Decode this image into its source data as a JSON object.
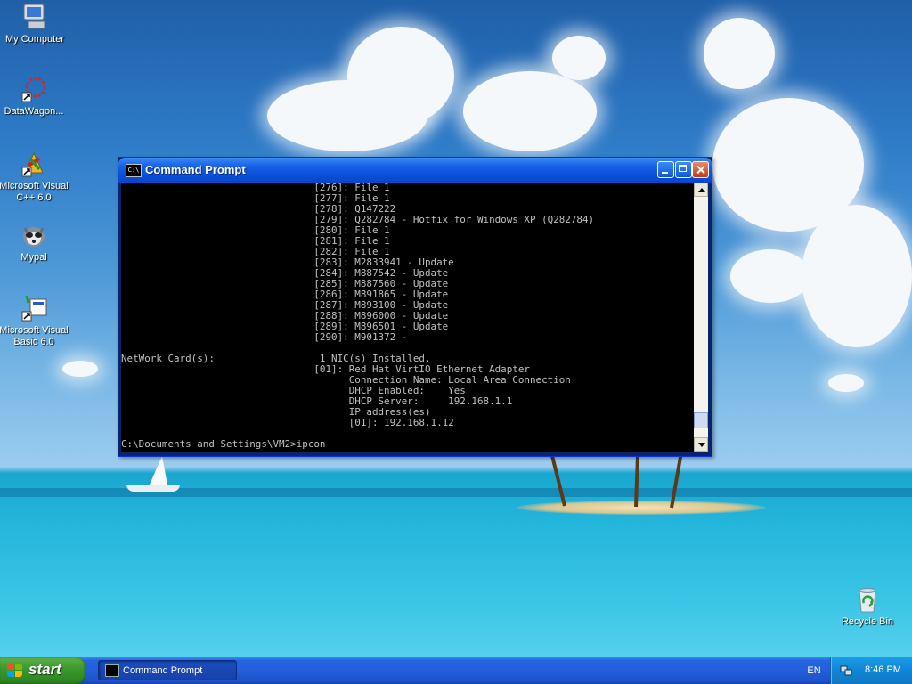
{
  "desktop": {
    "icons": [
      {
        "label": "My Computer",
        "icon": "computer-icon"
      },
      {
        "label": "DataWagon...",
        "icon": "shortcut-app-icon"
      },
      {
        "label": "Microsoft Visual C++ 6.0",
        "icon": "visual-cpp-icon"
      },
      {
        "label": "Mypal",
        "icon": "mypal-browser-icon"
      },
      {
        "label": "Microsoft Visual Basic 6.0",
        "icon": "visual-basic-icon"
      },
      {
        "label": "Recycle Bin",
        "icon": "recycle-bin-icon"
      }
    ]
  },
  "window": {
    "title": "Command Prompt",
    "icon_text": "C:\\",
    "console_lines": [
      "                                 [276]: File 1",
      "                                 [277]: File 1",
      "                                 [278]: Q147222",
      "                                 [279]: Q282784 - Hotfix for Windows XP (Q282784)",
      "                                 [280]: File 1",
      "                                 [281]: File 1",
      "                                 [282]: File 1",
      "                                 [283]: M2833941 - Update",
      "                                 [284]: M887542 - Update",
      "                                 [285]: M887560 - Update",
      "                                 [286]: M891865 - Update",
      "                                 [287]: M893100 - Update",
      "                                 [288]: M896000 - Update",
      "                                 [289]: M896501 - Update",
      "                                 [290]: M901372 -",
      "",
      "NetWork Card(s):                  1 NIC(s) Installed.",
      "                                 [01]: Red Hat VirtIO Ethernet Adapter",
      "                                       Connection Name: Local Area Connection",
      "                                       DHCP Enabled:    Yes",
      "                                       DHCP Server:     192.168.1.1",
      "                                       IP address(es)",
      "                                       [01]: 192.168.1.12",
      "",
      "C:\\Documents and Settings\\VM2>ipcon"
    ],
    "scroll_position": 0.96
  },
  "taskbar": {
    "start_label": "start",
    "tasks": [
      {
        "label": "Command Prompt"
      }
    ],
    "language": "EN",
    "clock": "8:46 PM"
  },
  "colors": {
    "console_bg": "#000000",
    "console_fg": "#c0c0c0",
    "titlebar": "#0a4fd8",
    "taskbar": "#245edb",
    "start_button": "#3c9a2e"
  }
}
